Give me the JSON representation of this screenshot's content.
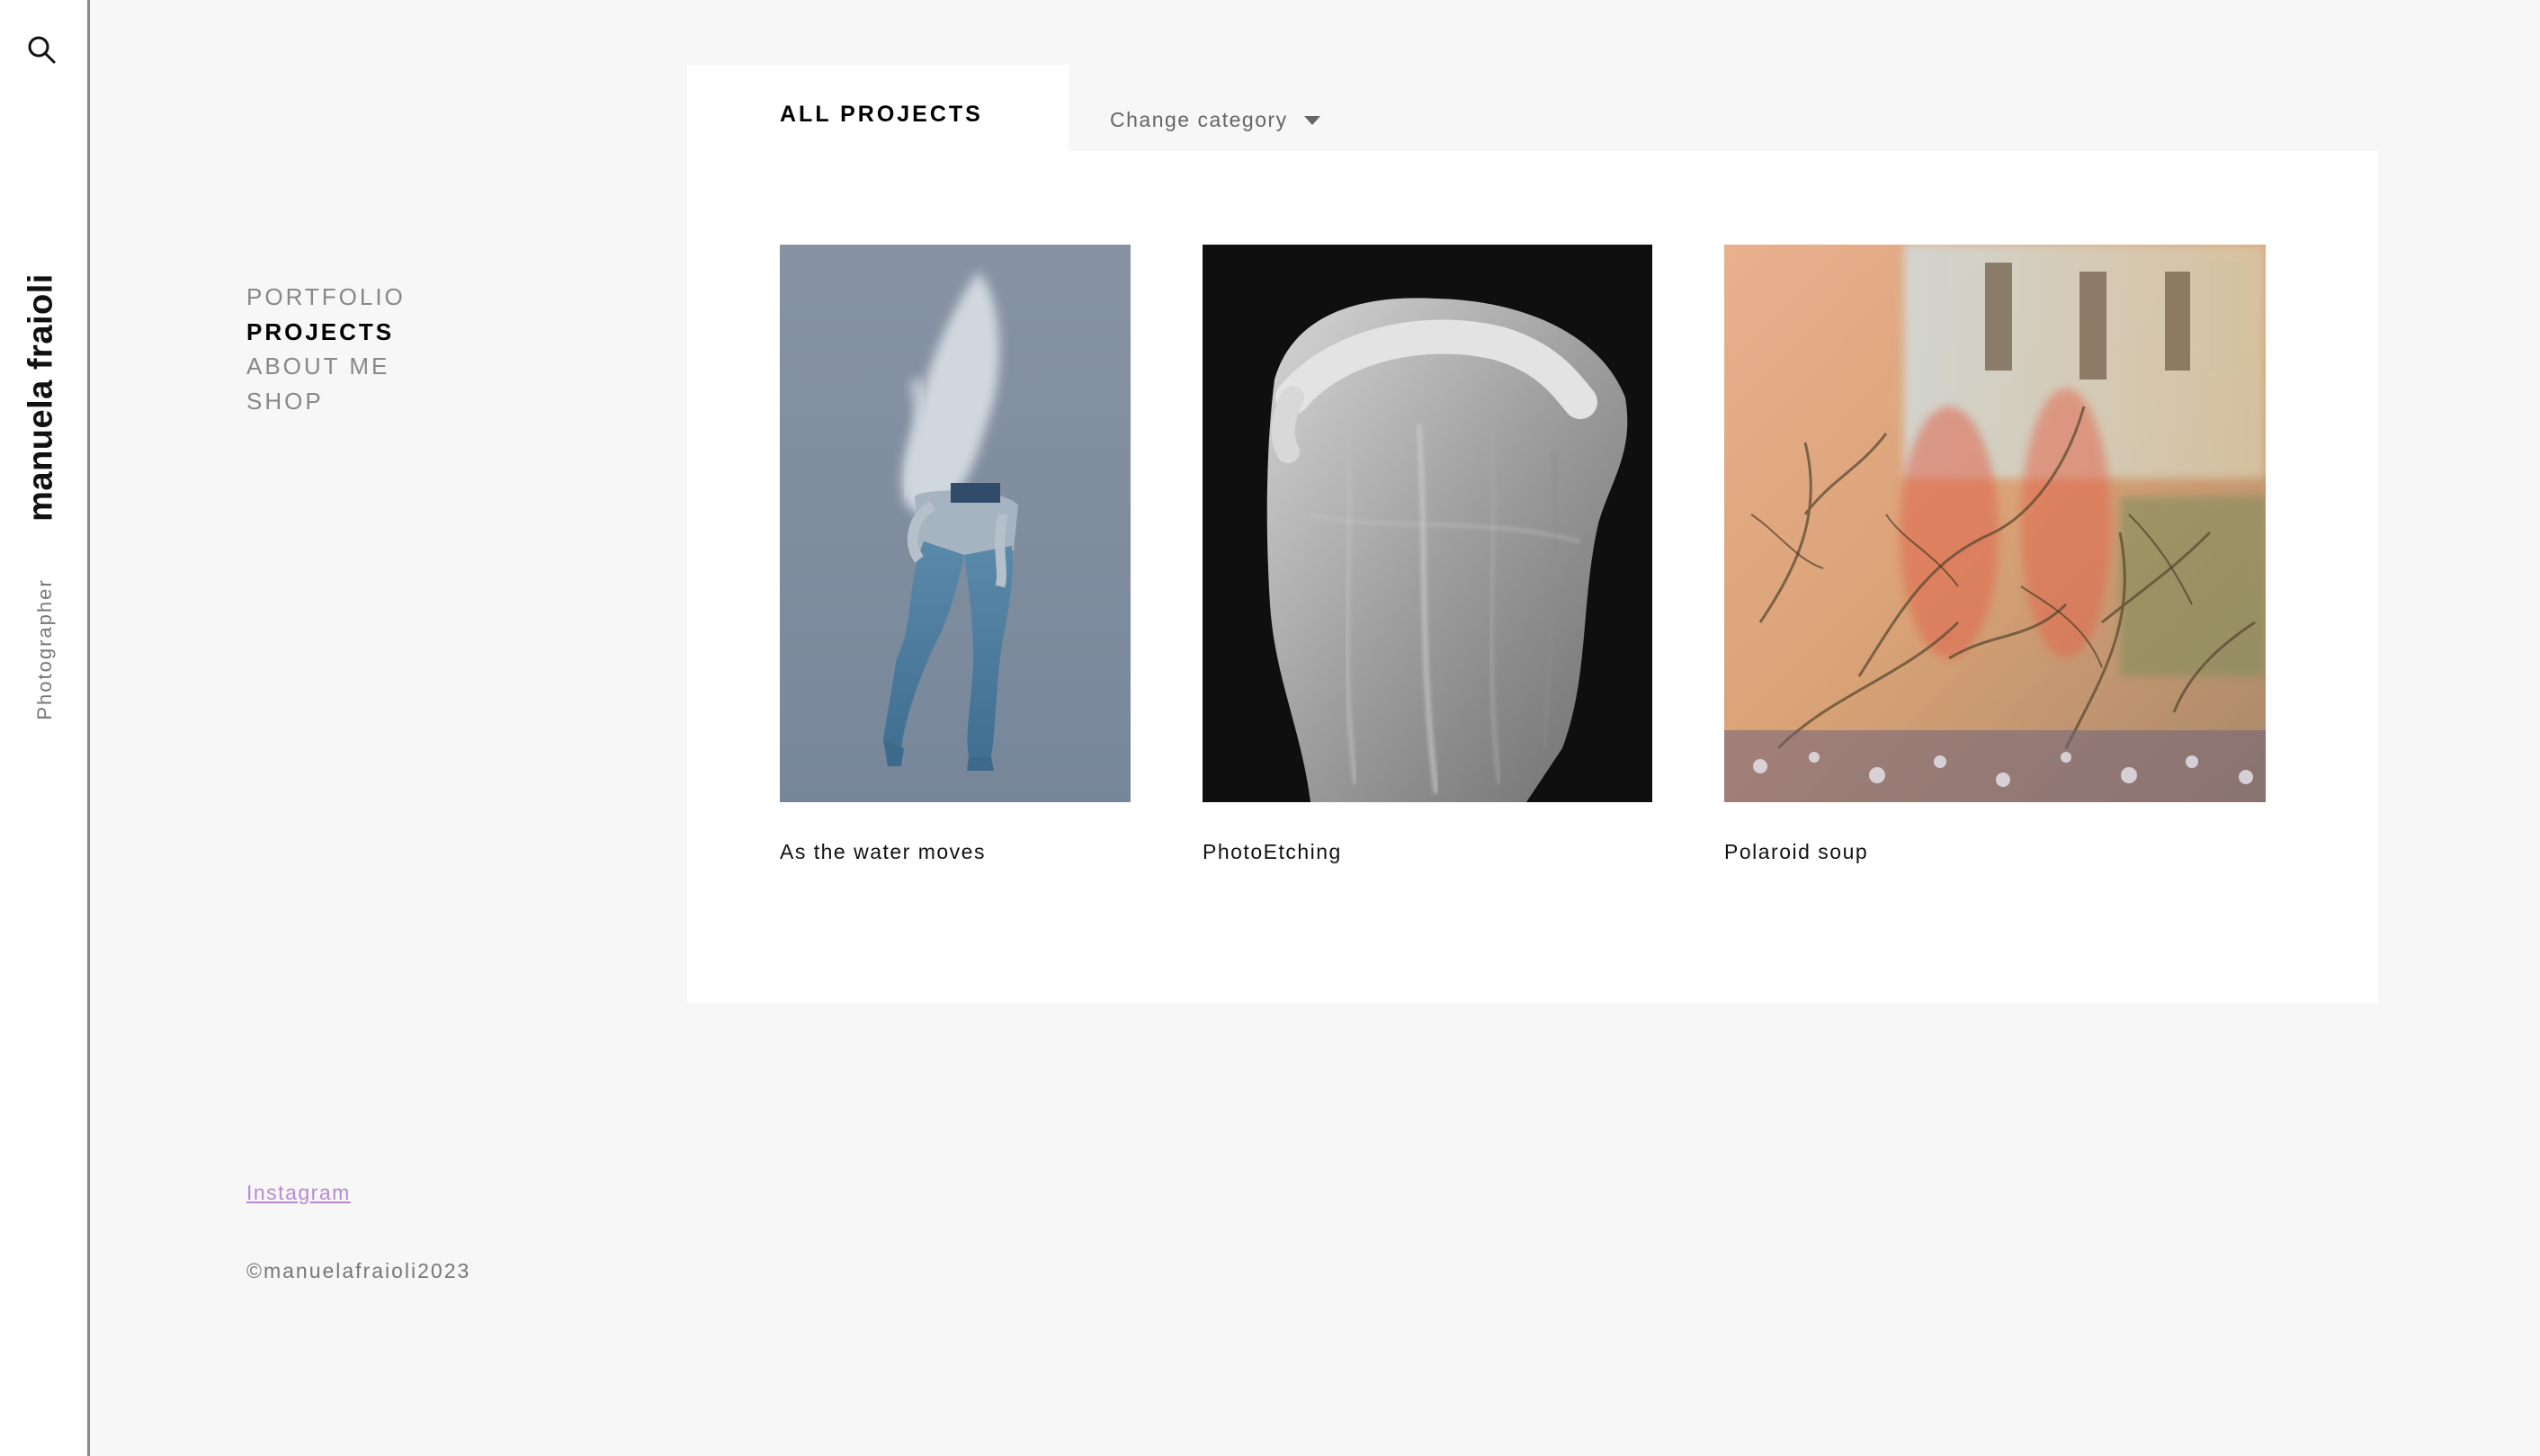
{
  "sidebar": {
    "search_icon": "search-icon",
    "brand_name": "manuela fraioli",
    "brand_role": "Photographer"
  },
  "nav": {
    "items": [
      {
        "label": "PORTFOLIO",
        "active": false
      },
      {
        "label": "PROJECTS",
        "active": true
      },
      {
        "label": "ABOUT ME",
        "active": false
      },
      {
        "label": "SHOP",
        "active": false
      }
    ]
  },
  "footer": {
    "instagram": "Instagram",
    "copyright": "©manuelafraioli2023"
  },
  "main": {
    "tab_label": "ALL PROJECTS",
    "category_label": "Change category",
    "projects": [
      {
        "title": "As the water moves"
      },
      {
        "title": "PhotoEtching"
      },
      {
        "title": "Polaroid soup"
      }
    ]
  },
  "colors": {
    "background": "#f7f7f7",
    "panel": "#ffffff",
    "nav_inactive": "#888888",
    "nav_active": "#000000",
    "link": "#b88ad0"
  }
}
